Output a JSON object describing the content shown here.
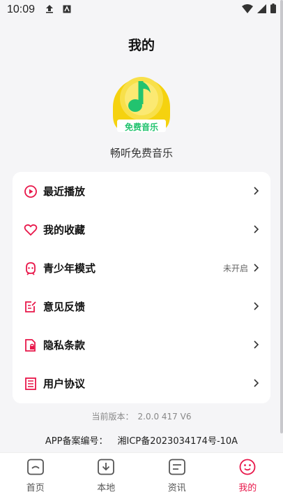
{
  "status_bar": {
    "time": "10:09"
  },
  "page": {
    "title": "我的"
  },
  "app": {
    "logo_text": "免费音乐",
    "name": "畅听免费音乐"
  },
  "menu": {
    "items": [
      {
        "label": "最近播放",
        "status": "",
        "icon": "play-circle-icon"
      },
      {
        "label": "我的收藏",
        "status": "",
        "icon": "heart-icon"
      },
      {
        "label": "青少年模式",
        "status": "未开启",
        "icon": "teen-face-icon"
      },
      {
        "label": "意见反馈",
        "status": "",
        "icon": "feedback-icon"
      },
      {
        "label": "隐私条款",
        "status": "",
        "icon": "privacy-lock-icon"
      },
      {
        "label": "用户协议",
        "status": "",
        "icon": "agreement-book-icon"
      }
    ]
  },
  "footer": {
    "version_label": "当前版本：",
    "version_value": "2.0.0 417 V6",
    "icp_label": "APP备案编号：",
    "icp_value": "湘ICP备2023034174号-10A"
  },
  "tabs": [
    {
      "label": "首页",
      "icon": "home-icon",
      "active": false
    },
    {
      "label": "本地",
      "icon": "download-icon",
      "active": false
    },
    {
      "label": "资讯",
      "icon": "news-icon",
      "active": false
    },
    {
      "label": "我的",
      "icon": "profile-face-icon",
      "active": true
    }
  ],
  "colors": {
    "accent": "#e8174a",
    "logo_yellow": "#f5d20f",
    "logo_green": "#22c36f"
  }
}
